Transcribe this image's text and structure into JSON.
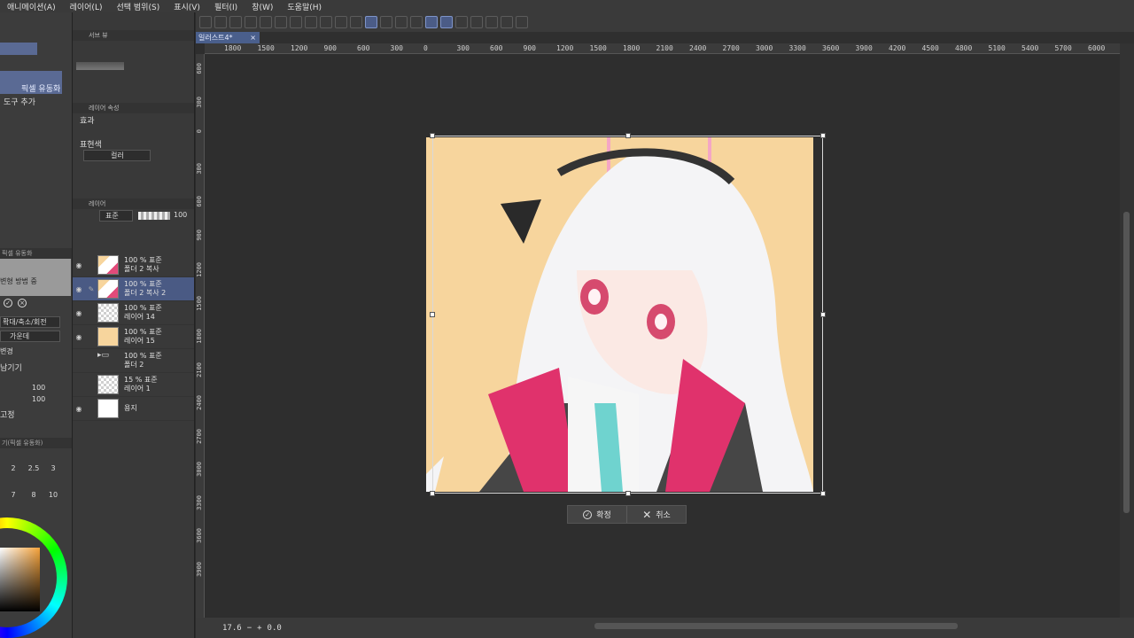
{
  "menu": [
    "애니메이션(A)",
    "레이어(L)",
    "선택 범위(S)",
    "표시(V)",
    "필터(I)",
    "창(W)",
    "도움말(H)"
  ],
  "left_panel": {
    "subtool_selected": "픽셀 유동화",
    "add_tool": "도구 추가",
    "tool_property_header": "픽셀 유동화",
    "mode_label": "변형 방법 중",
    "dropdown1": "확대/축소/회전",
    "dropdown2": "가운데",
    "change_label": "변경",
    "keep_label": "남기기",
    "slider1_value": "100",
    "slider2_value": "100",
    "fixed_label": "고정",
    "brush_header": "기(픽셀 유동화)",
    "brush_sizes": [
      "2",
      "2.5",
      "3",
      "7",
      "8",
      "10"
    ],
    "color_rgb": [
      "255",
      "220",
      "165"
    ]
  },
  "mid_panel": {
    "sub_view_tab": "서브 뷰",
    "layer_property_tab": "레이어 속성",
    "effect_label": "효과",
    "expression_label": "표현색",
    "expression_value": "컬러",
    "layer_tab": "레이어",
    "blend_mode": "표준",
    "opacity": "100",
    "layers": [
      {
        "opacity": "100 % 표준",
        "name": "폴더 2 복사",
        "thumb": "art",
        "visible": true,
        "selected": false
      },
      {
        "opacity": "100 % 표준",
        "name": "폴더 2 복사 2",
        "thumb": "art",
        "visible": true,
        "selected": true
      },
      {
        "opacity": "100 % 표준",
        "name": "레이어 14",
        "thumb": "trans",
        "visible": true,
        "selected": false
      },
      {
        "opacity": "100 % 표준",
        "name": "레이어 15",
        "thumb": "orange",
        "visible": true,
        "selected": false
      },
      {
        "opacity": "100 % 표준",
        "name": "폴더 2",
        "thumb": "folder",
        "visible": false,
        "selected": false
      },
      {
        "opacity": "15 % 표준",
        "name": "레이어 1",
        "thumb": "trans",
        "visible": false,
        "selected": false
      },
      {
        "opacity": "",
        "name": "용지",
        "thumb": "white",
        "visible": true,
        "selected": false
      }
    ]
  },
  "canvas": {
    "tab_title": "일러스트4*",
    "ruler_h": [
      "1800",
      "1500",
      "1200",
      "900",
      "600",
      "300",
      "0",
      "300",
      "600",
      "900",
      "1200",
      "1500",
      "1800",
      "2100",
      "2400",
      "2700",
      "3000",
      "3300",
      "3600",
      "3900",
      "4200",
      "4500",
      "4800",
      "5100",
      "5400",
      "5700",
      "6000"
    ],
    "ruler_v": [
      "600",
      "300",
      "0",
      "300",
      "600",
      "900",
      "1200",
      "1500",
      "1800",
      "2100",
      "2400",
      "2700",
      "3000",
      "3300",
      "3600",
      "3900"
    ],
    "zoom": "17.6",
    "rotation": "0.0",
    "confirm_label": "확정",
    "cancel_label": "취소"
  }
}
